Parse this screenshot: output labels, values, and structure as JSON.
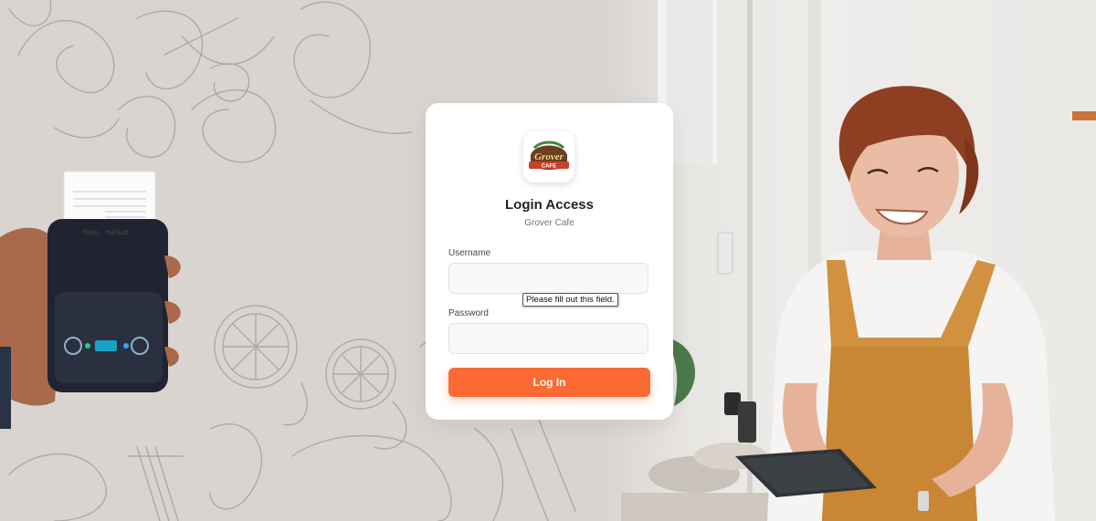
{
  "login": {
    "title": "Login Access",
    "subtitle": "Grover Cafe",
    "username_label": "Username",
    "username_value": "",
    "password_label": "Password",
    "password_value": "",
    "submit_label": "Log In",
    "validation_tooltip": "Please fill out this field."
  },
  "logo": {
    "brand_text": "Grover",
    "banner_text": "CAFE"
  },
  "receipt": {
    "total_label": "TOTAL",
    "total_value": "₹1475.00"
  },
  "colors": {
    "accent": "#fb6a33",
    "background": "#d9d4d0",
    "card": "#ffffff",
    "input_bg": "#f6f8fa",
    "title": "#1f2328",
    "subtitle": "#6b7280"
  }
}
